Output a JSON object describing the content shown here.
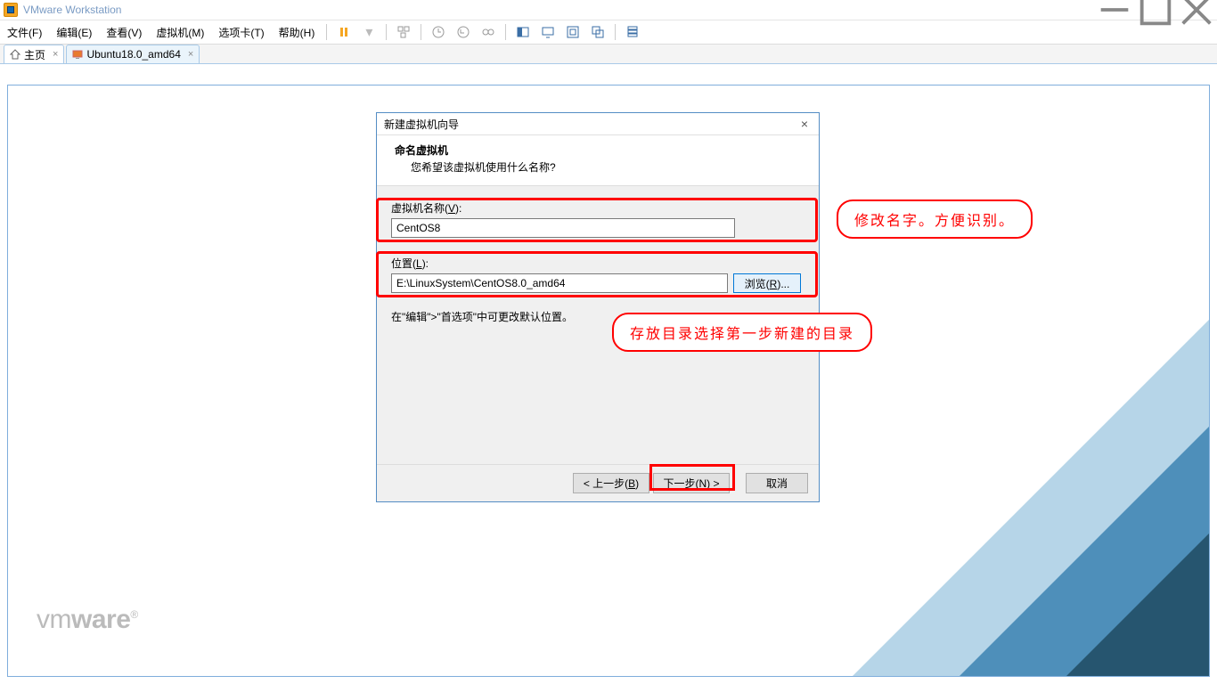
{
  "titlebar": {
    "title": "VMware Workstation"
  },
  "menubar": {
    "file": "文件(F)",
    "edit": "编辑(E)",
    "view": "查看(V)",
    "vm": "虚拟机(M)",
    "tabs": "选项卡(T)",
    "help": "帮助(H)"
  },
  "tabs": {
    "home": "主页",
    "vm1": "Ubuntu18.0_amd64"
  },
  "wizard": {
    "title": "新建虚拟机向导",
    "header_title": "命名虚拟机",
    "header_sub": "您希望该虚拟机使用什么名称?",
    "name_label": "虚拟机名称(V):",
    "name_value": "CentOS8",
    "loc_label": "位置(L):",
    "loc_value": "E:\\LinuxSystem\\CentOS8.0_amd64",
    "browse": "浏览(R)...",
    "hint": "在\"编辑\">\"首选项\"中可更改默认位置。",
    "back": "< 上一步(B)",
    "next": "下一步(N) >",
    "cancel": "取消"
  },
  "annotations": {
    "bubble1": "修改名字。方便识别。",
    "bubble2": "存放目录选择第一步新建的目录"
  },
  "logo": {
    "part1": "vm",
    "part2": "ware",
    "reg": "®"
  }
}
